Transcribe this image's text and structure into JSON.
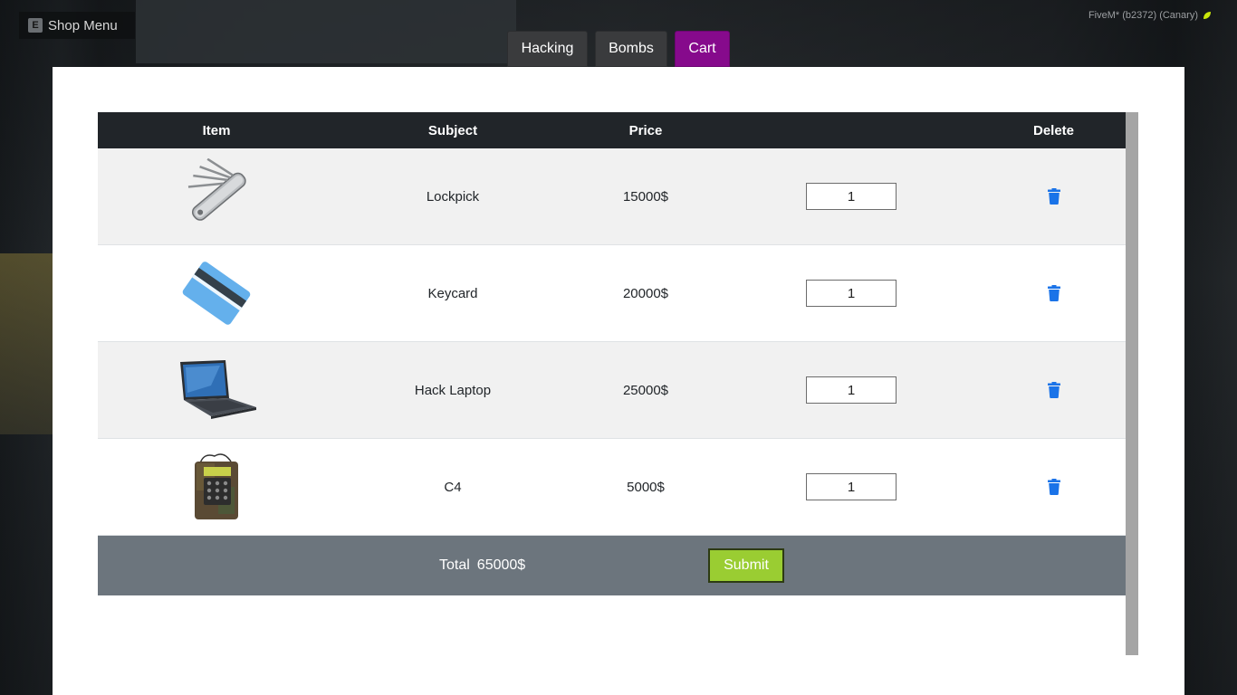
{
  "overlay": {
    "key_hint": "E",
    "menu_label": "Shop Menu",
    "build_info": "FiveM* (b2372) (Canary)"
  },
  "tabs": [
    {
      "label": "Hacking",
      "active": false
    },
    {
      "label": "Bombs",
      "active": false
    },
    {
      "label": "Cart",
      "active": true
    }
  ],
  "colors": {
    "active_tab": "#860a8c",
    "header_bg": "#212529",
    "footer_bg": "#6c757d",
    "submit_bg": "#9acd32",
    "trash": "#1a73e8"
  },
  "table": {
    "headers": {
      "item": "Item",
      "subject": "Subject",
      "price": "Price",
      "quantity": "",
      "delete": "Delete"
    },
    "rows": [
      {
        "icon": "lockpick-icon",
        "subject": "Lockpick",
        "price": "15000$",
        "quantity": "1"
      },
      {
        "icon": "keycard-icon",
        "subject": "Keycard",
        "price": "20000$",
        "quantity": "1"
      },
      {
        "icon": "laptop-icon",
        "subject": "Hack Laptop",
        "price": "25000$",
        "quantity": "1"
      },
      {
        "icon": "c4-icon",
        "subject": "C4",
        "price": "5000$",
        "quantity": "1"
      }
    ]
  },
  "footer": {
    "total_label": "Total",
    "total_value": "65000$",
    "submit_label": "Submit"
  }
}
